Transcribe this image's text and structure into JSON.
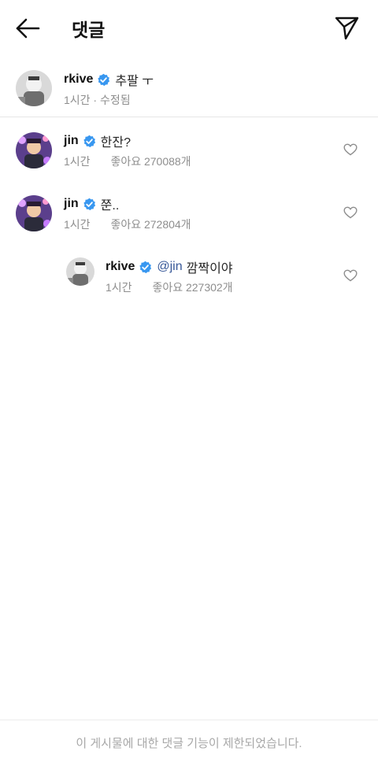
{
  "header": {
    "title": "댓글",
    "back_icon": "arrow-left-icon",
    "share_icon": "paper-plane-icon"
  },
  "caption": {
    "username": "rkive",
    "verified": true,
    "text": "추팔 ㅜ",
    "meta": "1시간 · 수정됨"
  },
  "comments": [
    {
      "username": "jin",
      "verified": true,
      "text": "한잔?",
      "time": "1시간",
      "likes": "좋아요 270088개"
    },
    {
      "username": "jin",
      "verified": true,
      "text": "쭌..",
      "time": "1시간",
      "likes": "좋아요 272804개"
    }
  ],
  "reply": {
    "username": "rkive",
    "verified": true,
    "mention": "@jin",
    "text": "깜짝이야",
    "time": "1시간",
    "likes": "좋아요 227302개"
  },
  "footer": {
    "notice": "이 게시물에 대한 댓글 기능이 제한되었습니다."
  },
  "colors": {
    "verified": "#3897f0",
    "mention": "#385898",
    "meta": "#8e8e8e"
  }
}
